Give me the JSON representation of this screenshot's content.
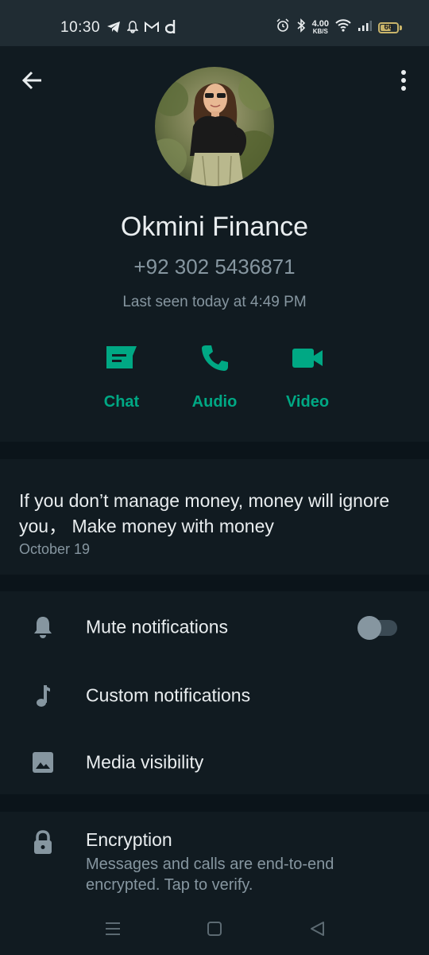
{
  "status_bar": {
    "time": "10:30",
    "net_speed_value": "4.00",
    "net_speed_unit": "KB/S",
    "battery": "66",
    "battery_fraction": 0.66,
    "left_icons": [
      "telegram-icon",
      "bell-icon",
      "gmail-icon",
      "daraz-d-icon"
    ],
    "right_icons": [
      "alarm-icon",
      "bluetooth-icon",
      "wifi-icon",
      "signal-icon",
      "battery-icon"
    ]
  },
  "header": {
    "back_icon": "arrow-back-icon",
    "menu_icon": "more-vert-icon"
  },
  "contact": {
    "name": "Okmini Finance",
    "phone": "+92 302 5436871",
    "last_seen": "Last seen today at 4:49 PM"
  },
  "actions": [
    {
      "label": "Chat",
      "icon": "chat-icon"
    },
    {
      "label": "Audio",
      "icon": "phone-icon"
    },
    {
      "label": "Video",
      "icon": "video-icon"
    }
  ],
  "about": {
    "text": "If you don’t manage money, money will ignore you，  Make money with money",
    "date": "October 19"
  },
  "settings": [
    {
      "label": "Mute notifications",
      "icon": "bell-icon",
      "toggle": false
    },
    {
      "label": "Custom notifications",
      "icon": "music-note-icon"
    },
    {
      "label": "Media visibility",
      "icon": "image-icon"
    }
  ],
  "encryption": {
    "title": "Encryption",
    "description": "Messages and calls are end-to-end encrypted. Tap to verify.",
    "icon": "lock-icon"
  },
  "nav_bar": {
    "icons": [
      "menu-lines-icon",
      "home-square-icon",
      "back-triangle-icon"
    ]
  },
  "colors": {
    "accent": "#00a884",
    "background": "#0b141a",
    "surface": "#111b21",
    "primary_text": "#e9edef",
    "secondary_text": "#8696a0"
  }
}
